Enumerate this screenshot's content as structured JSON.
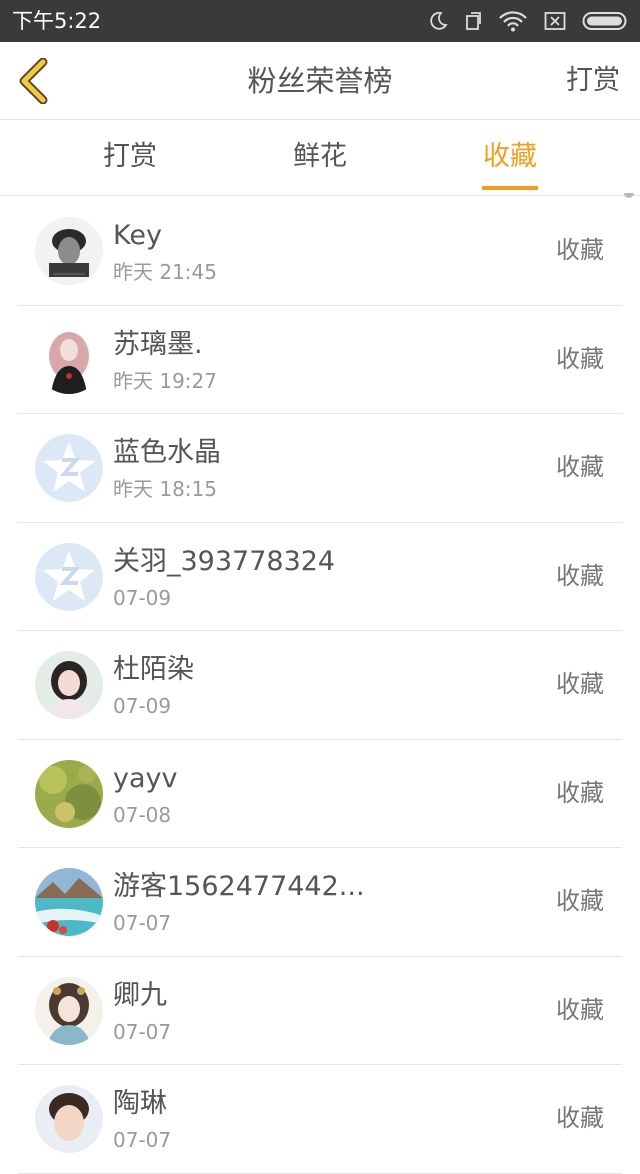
{
  "status_bar": {
    "time": "下午5:22"
  },
  "nav": {
    "title": "粉丝荣誉榜",
    "action": "打赏"
  },
  "tabs": [
    {
      "label": "打赏"
    },
    {
      "label": "鲜花"
    },
    {
      "label": "收藏"
    }
  ],
  "active_tab": "收藏",
  "colors": {
    "accent": "#f0a020",
    "status_bar": "#3a3a3a",
    "text": "#555555",
    "subtext": "#9a9a9a"
  },
  "fans": [
    {
      "name": "Key",
      "time": "昨天 21:45",
      "action": "收藏",
      "avatar": "photo-avatar"
    },
    {
      "name": "苏璃墨.",
      "time": "昨天 19:27",
      "action": "收藏",
      "avatar": "illustration-avatar"
    },
    {
      "name": "蓝色水晶",
      "time": "昨天 18:15",
      "action": "收藏",
      "avatar": "default-star-avatar"
    },
    {
      "name": "关羽_393778324",
      "time": "07-09",
      "action": "收藏",
      "avatar": "default-star-avatar"
    },
    {
      "name": "杜陌染",
      "time": "07-09",
      "action": "收藏",
      "avatar": "photo-avatar"
    },
    {
      "name": "yayv",
      "time": "07-08",
      "action": "收藏",
      "avatar": "photo-avatar"
    },
    {
      "name": "游客1562477442...",
      "time": "07-07",
      "action": "收藏",
      "avatar": "landscape-avatar"
    },
    {
      "name": "卿九",
      "time": "07-07",
      "action": "收藏",
      "avatar": "illustration-avatar"
    },
    {
      "name": "陶琳",
      "time": "07-07",
      "action": "收藏",
      "avatar": "photo-avatar"
    }
  ]
}
